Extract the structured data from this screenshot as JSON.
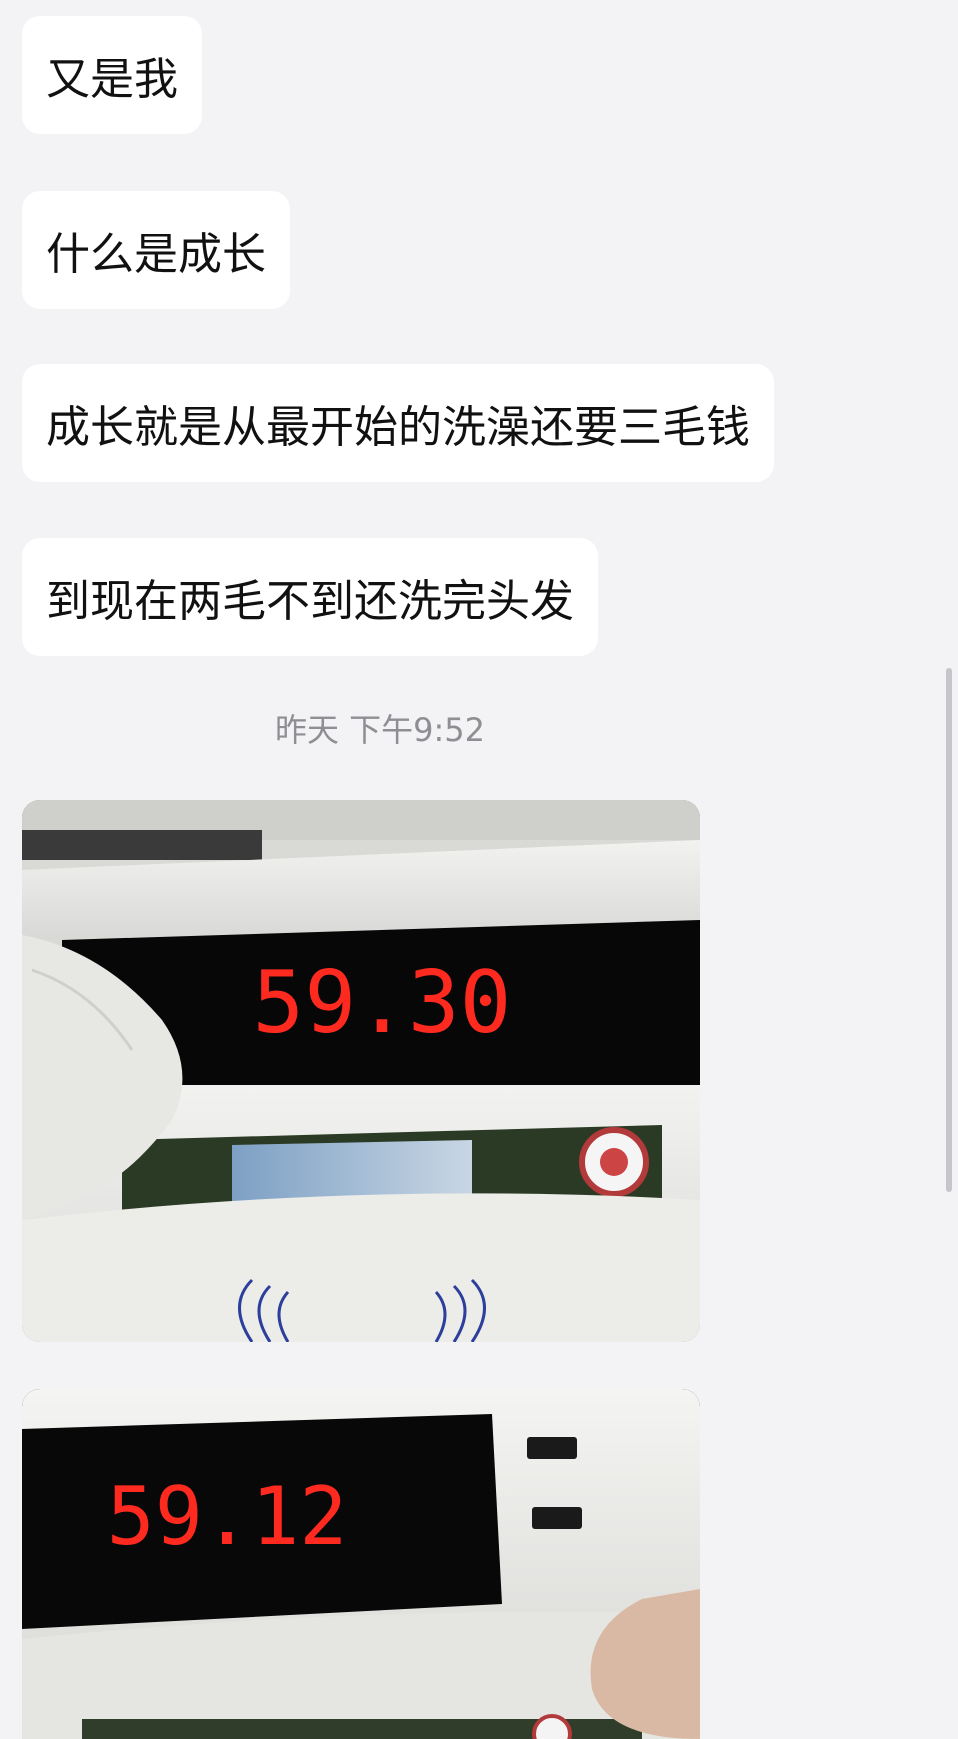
{
  "messages": [
    {
      "text": "又是我"
    },
    {
      "text": "什么是成长"
    },
    {
      "text": "成长就是从最开始的洗澡还要三毛钱"
    },
    {
      "text": "到现在两毛不到还洗完头发"
    }
  ],
  "timestamp": "昨天 下午9:52",
  "photos": [
    {
      "meter_reading": "59.30"
    },
    {
      "meter_reading": "59.12"
    }
  ],
  "colors": {
    "background": "#f3f3f6",
    "bubble": "#ffffff",
    "timestamp_text": "#8e8e93",
    "led": "#ff2a1f"
  }
}
